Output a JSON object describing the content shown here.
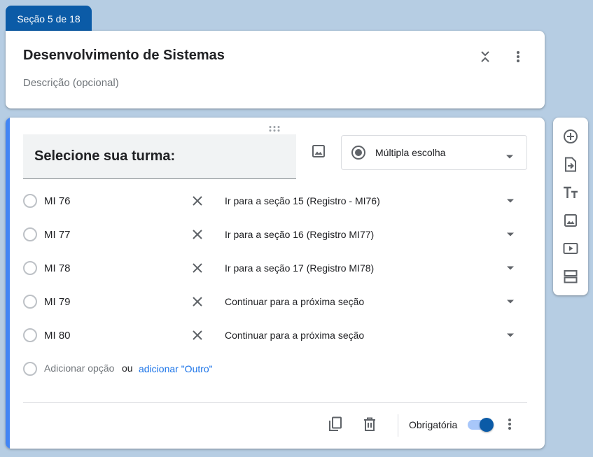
{
  "section_tab": "Seção 5 de 18",
  "section": {
    "title": "Desenvolvimento de Sistemas",
    "description_placeholder": "Descrição (opcional)",
    "icons": [
      "collapse-icon",
      "more-vert-icon"
    ]
  },
  "question": {
    "title": "Selecione sua turma:",
    "type": "Múltipla escolha",
    "options": [
      {
        "label": "MI 76",
        "go_to": "Ir para a seção 15 (Registro - MI76)"
      },
      {
        "label": "MI 77",
        "go_to": "Ir para a seção 16 (Registro MI77)"
      },
      {
        "label": "MI 78",
        "go_to": "Ir para a seção 17 (Registro MI78)"
      },
      {
        "label": "MI 79",
        "go_to": "Continuar para a próxima seção"
      },
      {
        "label": "MI 80",
        "go_to": "Continuar para a próxima seção"
      }
    ],
    "add_option": "Adicionar opção",
    "or": "ou",
    "add_other": "adicionar \"Outro\"",
    "required_label": "Obrigatória",
    "required": true
  },
  "toolbar": {
    "icons": [
      "add-question-icon",
      "import-questions-icon",
      "add-title-icon",
      "add-image-icon",
      "add-video-icon",
      "add-section-icon"
    ]
  },
  "colors": {
    "background": "#b6cde3",
    "accent": "#0b5ba7",
    "link": "#1a73e8",
    "left_accent": "#4285f4"
  }
}
